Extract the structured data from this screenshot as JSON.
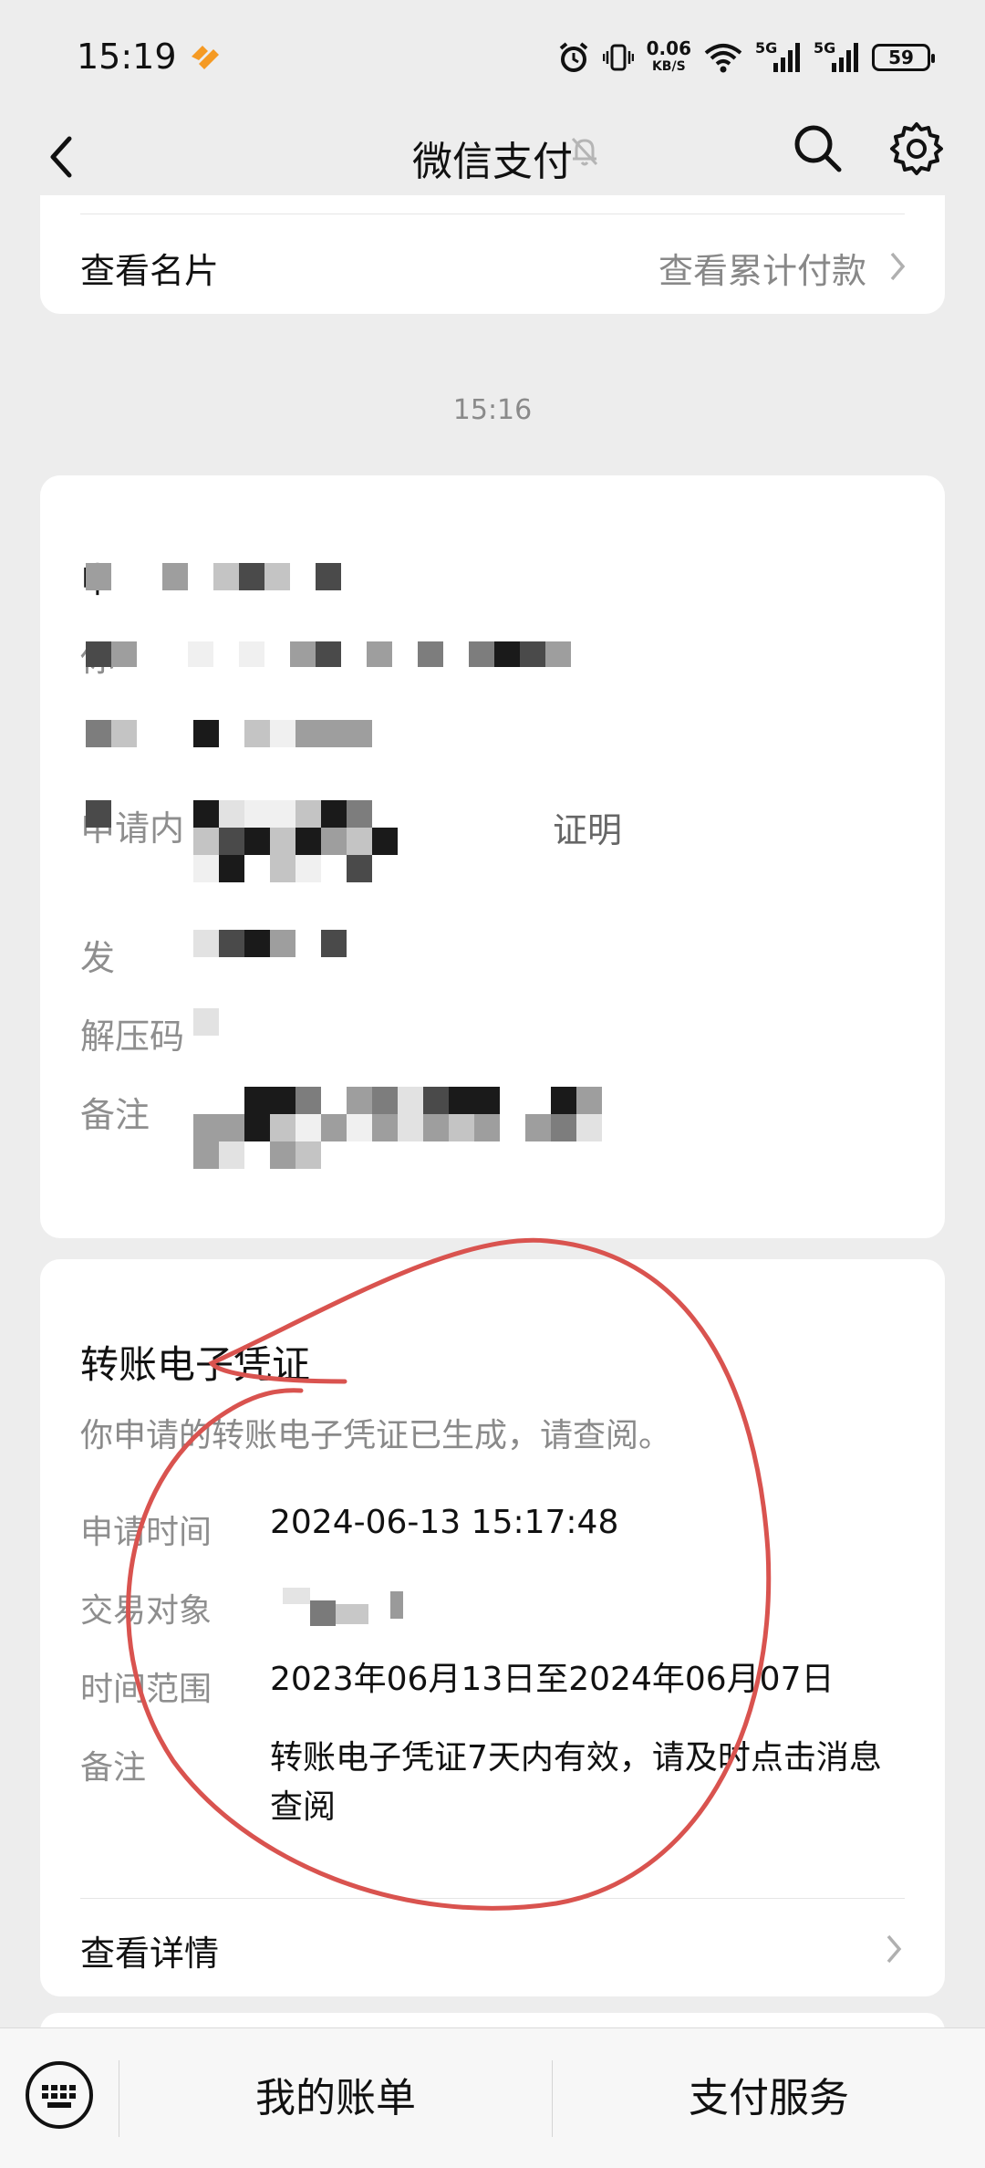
{
  "status_bar": {
    "time": "15:19",
    "net_speed_value": "0.06",
    "net_speed_unit": "KB/S",
    "signal1": "5G",
    "signal2": "5G",
    "battery": "59",
    "icons": [
      "app-icon",
      "alarm-icon",
      "vibrate-icon",
      "wifi-icon",
      "signal-icon",
      "signal-icon",
      "battery-icon"
    ]
  },
  "nav": {
    "title": "微信支付",
    "icons": [
      "back-icon",
      "bell-muted-icon",
      "search-icon",
      "gear-icon"
    ]
  },
  "card_top": {
    "left_label": "查看名片",
    "right_label": "查看累计付款"
  },
  "timestamp": "15:16",
  "card_redacted": {
    "labels": [
      "申",
      "你",
      "申请内",
      "发",
      "解压码",
      "备注"
    ],
    "partial_text": "证明"
  },
  "voucher": {
    "title": "转账电子凭证",
    "subtitle": "你申请的转账电子凭证已生成，请查阅。",
    "rows": [
      {
        "label": "申请时间",
        "value": "2024-06-13 15:17:48"
      },
      {
        "label": "交易对象",
        "value": ""
      },
      {
        "label": "时间范围",
        "value": "2023年06月13日至2024年06月07日"
      },
      {
        "label": "备注",
        "value": "转账电子凭证7天内有效，请及时点击消息查阅"
      }
    ],
    "detail_label": "查看详情"
  },
  "bottom_bar": {
    "bill": "我的账单",
    "service": "支付服务",
    "icons": [
      "keyboard-icon"
    ]
  },
  "colors": {
    "background": "#ededed",
    "card": "#ffffff",
    "annotation": "#d9534f",
    "muted_text": "#8e8e8e"
  }
}
